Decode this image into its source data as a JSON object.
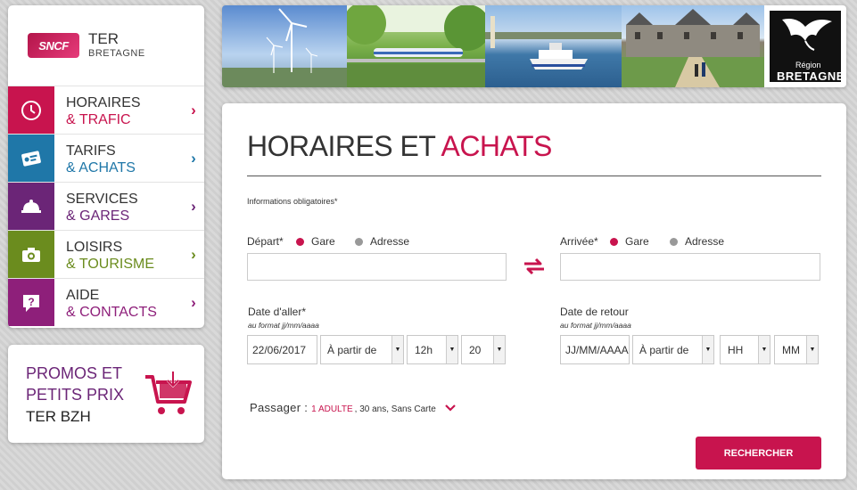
{
  "brand": {
    "logo_text": "SNCF",
    "title": "TER",
    "subtitle": "BRETAGNE"
  },
  "nav": [
    {
      "line1": "HORAIRES",
      "line2": "& TRAFIC",
      "color": "#c8144e",
      "icon": "clock-icon"
    },
    {
      "line1": "TARIFS",
      "line2": "& ACHATS",
      "color": "#1f77a8",
      "icon": "ticket-icon"
    },
    {
      "line1": "SERVICES",
      "line2": "& GARES",
      "color": "#6b2577",
      "icon": "bell-icon"
    },
    {
      "line1": "LOISIRS",
      "line2": "& TOURISME",
      "color": "#6b8c1e",
      "icon": "camera-icon"
    },
    {
      "line1": "AIDE",
      "line2": "& CONTACTS",
      "color": "#8e1f7a",
      "icon": "help-icon"
    }
  ],
  "promo": {
    "line1": "PROMOS ET",
    "line2": "PETITS PRIX",
    "line3": "TER BZH",
    "icon": "cart-icon"
  },
  "banner": {
    "region_small": "Région",
    "region_big": "BRETAGNE"
  },
  "main": {
    "title_part1": "HORAIRES ET",
    "title_part2": "ACHATS",
    "required_note": "Informations obligatoires*",
    "departure": {
      "label": "Départ*",
      "opt1": "Gare",
      "opt2": "Adresse",
      "value": ""
    },
    "arrival": {
      "label": "Arrivée*",
      "opt1": "Gare",
      "opt2": "Adresse",
      "value": ""
    },
    "outbound": {
      "label": "Date d'aller*",
      "hint": "au format jj/mm/aaaa",
      "date": "22/06/2017",
      "mode": "À partir de",
      "hour": "12h",
      "minute": "20"
    },
    "return": {
      "label": "Date de retour",
      "hint": "au format jj/mm/aaaa",
      "date": "JJ/MM/AAAA",
      "mode": "À partir de",
      "hour": "HH",
      "minute": "MM"
    },
    "passenger": {
      "label": "Passager :",
      "count": "1 ADULTE",
      "details": ", 30 ans, Sans Carte"
    },
    "search_label": "RECHERCHER"
  }
}
